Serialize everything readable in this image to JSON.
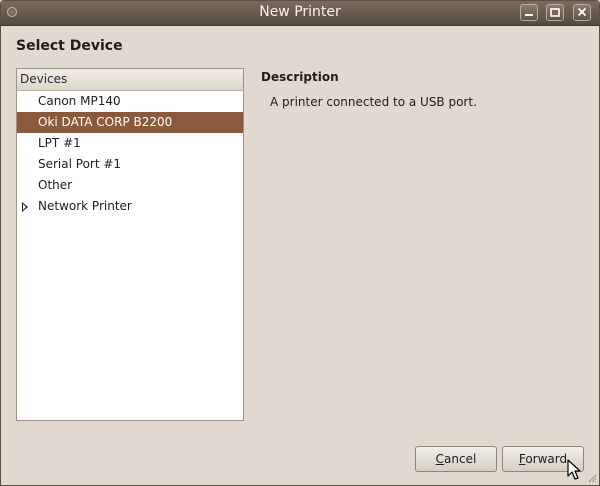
{
  "window": {
    "title": "New Printer"
  },
  "heading": "Select Device",
  "device_list": {
    "header": "Devices",
    "items": [
      {
        "label": "Canon MP140",
        "selected": false,
        "expandable": false
      },
      {
        "label": "Oki DATA CORP B2200",
        "selected": true,
        "expandable": false
      },
      {
        "label": "LPT #1",
        "selected": false,
        "expandable": false
      },
      {
        "label": "Serial Port #1",
        "selected": false,
        "expandable": false
      },
      {
        "label": "Other",
        "selected": false,
        "expandable": false
      },
      {
        "label": "Network Printer",
        "selected": false,
        "expandable": true
      }
    ]
  },
  "description": {
    "title": "Description",
    "text": "A printer connected to a USB port."
  },
  "buttons": {
    "cancel": {
      "mnemonic": "C",
      "rest": "ancel"
    },
    "forward": {
      "mnemonic": "F",
      "rest": "orward"
    }
  },
  "icons": {
    "window_menu": "window-menu-icon",
    "minimize": "minimize-icon",
    "maximize": "maximize-icon",
    "close": "close-icon",
    "expander": "triangle-right-icon",
    "cursor": "mouse-pointer-icon"
  },
  "colors": {
    "selection": "#8b5a3c",
    "titlebar": "#5d5246",
    "background": "#e1d9cf"
  }
}
